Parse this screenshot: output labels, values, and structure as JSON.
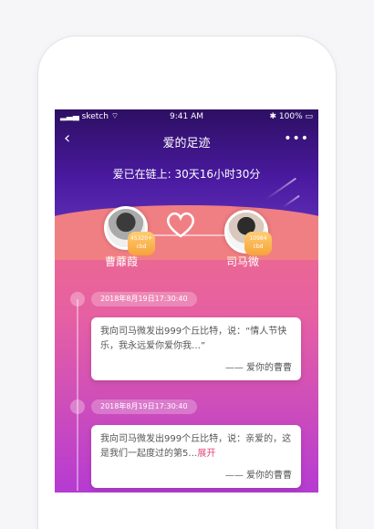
{
  "status": {
    "carrier": "sketch",
    "time": "9:41 AM",
    "battery": "100%"
  },
  "nav": {
    "back_icon": "chevron-left-icon",
    "title": "爱的足迹",
    "more_icon": "more-icon"
  },
  "love_time": "爱已在链上: 30天16小时30分",
  "couple": {
    "left": {
      "name": "曹蘼葭",
      "score": "45320+",
      "score_unit": "cbd"
    },
    "right": {
      "name": "司马微",
      "score": "10984",
      "score_unit": "cbd"
    }
  },
  "timeline": [
    {
      "date": "2018年8月19日17:30:40",
      "text": "我向司马微发出999个丘比特，说：“情人节快乐，我永远爱你爱你我…”",
      "expand": "",
      "signature": "—— 爱你的曹曹"
    },
    {
      "date": "2018年8月19日17:30:40",
      "text": "我向司马微发出999个丘比特，说：亲爱的，这是我们一起度过的第5…",
      "expand": "展开",
      "signature": "—— 爱你的曹曹"
    }
  ]
}
